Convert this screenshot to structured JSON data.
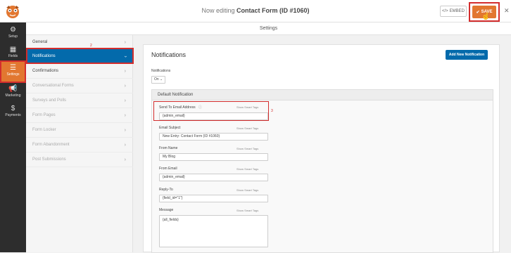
{
  "header": {
    "title_prefix": "Now editing",
    "title_form": "Contact Form (ID #1060)",
    "embed_label": "EMBED",
    "save_label": "SAVE",
    "close_label": "✕"
  },
  "annotations": {
    "save": "4",
    "subnav": "2",
    "field": "3"
  },
  "leftnav": [
    {
      "label": "Setup",
      "icon": "⚙"
    },
    {
      "label": "Fields",
      "icon": "▦"
    },
    {
      "label": "Settings",
      "icon": "☰"
    },
    {
      "label": "Marketing",
      "icon": "📢"
    },
    {
      "label": "Payments",
      "icon": "$"
    }
  ],
  "subheader": "Settings",
  "subnav": [
    {
      "label": "General",
      "chev": "›"
    },
    {
      "label": "Notifications",
      "chev": "›"
    },
    {
      "label": "Confirmations",
      "chev": "›"
    },
    {
      "label": "Conversational Forms",
      "chev": "›"
    },
    {
      "label": "Surveys and Polls",
      "chev": "›"
    },
    {
      "label": "Form Pages",
      "chev": "›"
    },
    {
      "label": "Form Locker",
      "chev": "›"
    },
    {
      "label": "Form Abandonment",
      "chev": "›"
    },
    {
      "label": "Post Submissions",
      "chev": "›"
    }
  ],
  "panel": {
    "title": "Notifications",
    "add_button": "Add New Notification",
    "notifications_label": "Notifications",
    "notifications_value": "On ⌄",
    "default_title": "Default Notification",
    "smart_tags": "Show Smart Tags",
    "fields": [
      {
        "label": "Send To Email Address",
        "value": "{admin_email}"
      },
      {
        "label": "Email Subject",
        "value": "New Entry: Contact Form (ID #1060)"
      },
      {
        "label": "From Name",
        "value": "My Blog"
      },
      {
        "label": "From Email",
        "value": "{admin_email}"
      },
      {
        "label": "Reply-To",
        "value": "{field_id=\"1\"}"
      },
      {
        "label": "Message",
        "value": "{all_fields}"
      }
    ]
  },
  "colors": {
    "accent": "#e27730",
    "primary": "#036aab",
    "annotation": "#d32d2d",
    "sidebar": "#2d2d2d"
  }
}
